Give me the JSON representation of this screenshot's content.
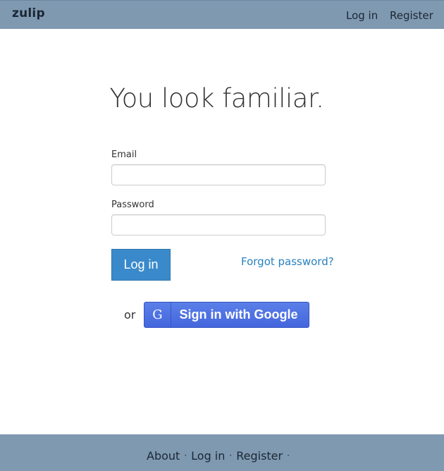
{
  "header": {
    "brand": "zulip",
    "nav": [
      {
        "label": "Log in"
      },
      {
        "label": "Register"
      }
    ]
  },
  "main": {
    "title": "You look familiar.",
    "email_label": "Email",
    "email_value": "",
    "password_label": "Password",
    "password_value": "",
    "login_button": "Log in",
    "forgot_link": "Forgot password?",
    "or_text": "or",
    "google_icon_glyph": "G",
    "google_button": "Sign in with Google"
  },
  "footer": {
    "links": [
      {
        "label": "About"
      },
      {
        "label": "Log in"
      },
      {
        "label": "Register"
      }
    ],
    "separator": "·"
  },
  "colors": {
    "bar_background": "#7f99b1",
    "login_button": "#3a8acb",
    "link": "#2a81c1",
    "google_button": "#4466dd"
  }
}
